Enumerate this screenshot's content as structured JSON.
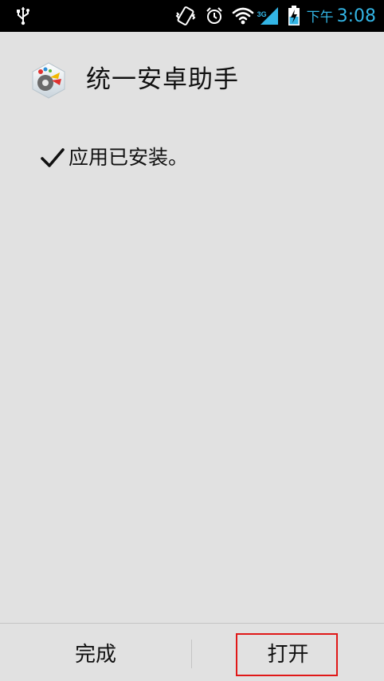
{
  "status_bar": {
    "network_type": "3G",
    "ampm": "下午",
    "time": "3:08",
    "icons": [
      "usb-icon",
      "vibrate-icon",
      "alarm-icon",
      "wifi-icon",
      "signal-icon",
      "battery-charging-icon"
    ],
    "accent_color": "#33b5e5"
  },
  "header": {
    "app_name": "统一安卓助手",
    "icon": "app-logo-icon"
  },
  "message": {
    "text": "应用已安装。",
    "icon": "checkmark-icon"
  },
  "buttons": {
    "done_label": "完成",
    "open_label": "打开"
  },
  "colors": {
    "background": "#e1e1e1",
    "status_bar": "#000000",
    "highlight": "#e01818"
  }
}
